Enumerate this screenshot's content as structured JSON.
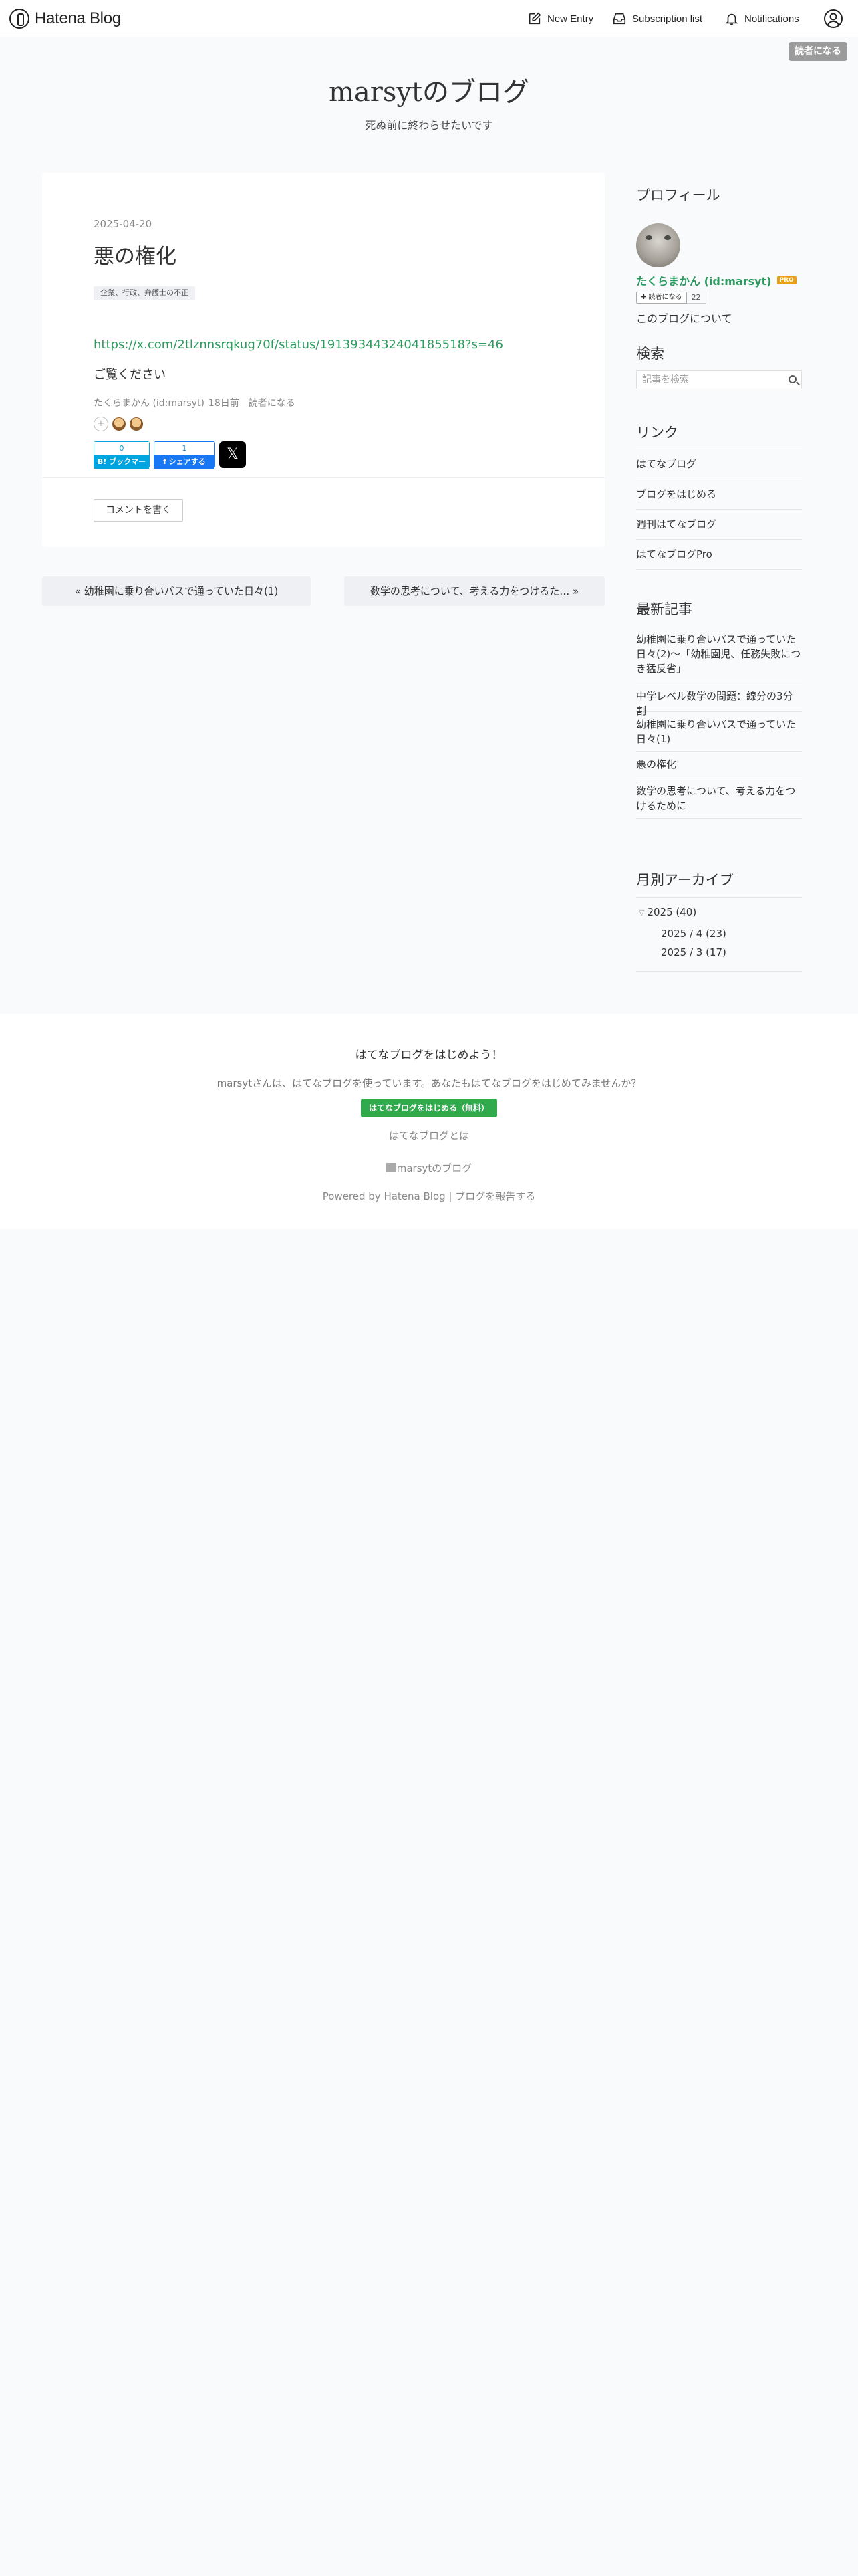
{
  "global_header": {
    "logo_text": "Hatena Blog",
    "new_entry": "New Entry",
    "subscription_list": "Subscription list",
    "notifications": "Notifications"
  },
  "reader_button": "読者になる",
  "blog": {
    "title": "marsytのブログ",
    "description": "死ぬ前に終わらせたいです"
  },
  "entry": {
    "date": "2025-04-20",
    "title": "悪の権化",
    "tag": "企業、行政、弁護士の不正",
    "link": "https://x.com/2tlznnsrqkug70f/status/1913934432404185518?s=46",
    "body": "ご覧ください",
    "author": "たくらまかん (id:marsyt)",
    "ago": "18日前",
    "subscribe": "読者になる",
    "star_add": "+",
    "hatebu_count": "0",
    "hatebu_label": "B! ブックマーク",
    "fb_count": "1",
    "fb_label": "f シェアする",
    "x_label": "𝕏",
    "comment_button": "コメントを書く"
  },
  "pager": {
    "prev": "« 幼稚園に乗り合いバスで通っていた日々(1)",
    "next": "数学の思考について、考える力をつけるた… »"
  },
  "sidebar": {
    "profile_heading": "プロフィール",
    "user_name": "たくらまかん (id:marsyt)",
    "pro_badge": "PRO",
    "follow_button": "✚ 読者になる",
    "follow_count": "22",
    "about_link": "このブログについて",
    "search_heading": "検索",
    "search_placeholder": "記事を検索",
    "links_heading": "リンク",
    "links": [
      "はてなブログ",
      "ブログをはじめる",
      "週刊はてなブログ",
      "はてなブログPro"
    ],
    "recent_heading": "最新記事",
    "recent": [
      "幼稚園に乗り合いバスで通っていた日々(2)〜「幼稚園児、任務失敗につき猛反省」",
      "中学レベル数学の問題：線分の3分割",
      "幼稚園に乗り合いバスで通っていた日々(1)",
      "悪の権化",
      "数学の思考について、考える力をつけるために"
    ],
    "archive_heading": "月別アーカイブ",
    "archive_year": "2025 (40)",
    "archive_year_toggle": "▽",
    "archive_months": [
      "2025 / 4 (23)",
      "2025 / 3 (17)"
    ]
  },
  "footer": {
    "title": "はてなブログをはじめよう！",
    "text": "marsytさんは、はてなブログを使っています。あなたもはてなブログをはじめてみませんか？",
    "start_button": "はてなブログをはじめる（無料）",
    "about": "はてなブログとは",
    "blog_name": "marsytのブログ",
    "powered": "Powered by Hatena Blog | ブログを報告する"
  }
}
